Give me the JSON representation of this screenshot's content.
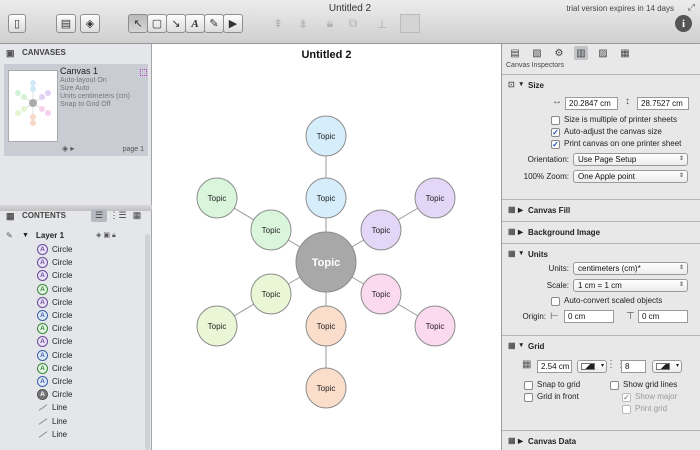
{
  "window": {
    "title": "Untitled 2",
    "trial_notice": "trial version expires in 14 days"
  },
  "toolbar": {
    "icons": [
      "sidebar-toggle-icon",
      "canvas-stack-icon",
      "layers-icon",
      "selection-tool-icon",
      "shape-tool-icon",
      "line-tool-icon",
      "text-tool-icon",
      "pen-tool-icon",
      "browse-tool-icon",
      "bring-front-icon",
      "send-back-icon",
      "lock-icon",
      "group-icon",
      "color-well-icon",
      "info-icon"
    ]
  },
  "sidebar": {
    "canvases_title": "CANVASES",
    "canvas": {
      "name": "Canvas 1",
      "props": [
        "Auto-layout On",
        "Size Auto",
        "Units centimeters (cm)",
        "Snap to Grid Off"
      ],
      "page_label": "page 1"
    },
    "contents_title": "CONTENTS",
    "layer_name": "Layer 1",
    "items": [
      {
        "type": "circle",
        "label": "Circle",
        "letter": "A",
        "tone": "purple"
      },
      {
        "type": "circle",
        "label": "Circle",
        "letter": "A",
        "tone": "purple"
      },
      {
        "type": "circle",
        "label": "Circle",
        "letter": "A",
        "tone": "purple"
      },
      {
        "type": "circle",
        "label": "Circle",
        "letter": "A",
        "tone": "green"
      },
      {
        "type": "circle",
        "label": "Circle",
        "letter": "A",
        "tone": "purple"
      },
      {
        "type": "circle",
        "label": "Circle",
        "letter": "A",
        "tone": "blue"
      },
      {
        "type": "circle",
        "label": "Circle",
        "letter": "A",
        "tone": "green"
      },
      {
        "type": "circle",
        "label": "Circle",
        "letter": "A",
        "tone": "purple"
      },
      {
        "type": "circle",
        "label": "Circle",
        "letter": "A",
        "tone": "blue"
      },
      {
        "type": "circle",
        "label": "Circle",
        "letter": "A",
        "tone": "green"
      },
      {
        "type": "circle",
        "label": "Circle",
        "letter": "A",
        "tone": "blue"
      },
      {
        "type": "circle",
        "label": "Circle",
        "letter": "A",
        "tone": "gray"
      },
      {
        "type": "line",
        "label": "Line"
      },
      {
        "type": "line",
        "label": "Line"
      },
      {
        "type": "line",
        "label": "Line"
      }
    ]
  },
  "canvas_view": {
    "title": "Untitled 2",
    "center": {
      "label": "Topic",
      "fill": "#a8a8a8"
    },
    "nodes": [
      {
        "label": "Topic",
        "fill": "#d6eefb"
      },
      {
        "label": "Topic",
        "fill": "#d6eefb"
      },
      {
        "label": "Topic",
        "fill": "#e4d6f7"
      },
      {
        "label": "Topic",
        "fill": "#e4d6f7"
      },
      {
        "label": "Topic",
        "fill": "#fbd9ef"
      },
      {
        "label": "Topic",
        "fill": "#fbd9ef"
      },
      {
        "label": "Topic",
        "fill": "#fbddcc"
      },
      {
        "label": "Topic",
        "fill": "#fbddcc"
      },
      {
        "label": "Topic",
        "fill": "#eaf7d6"
      },
      {
        "label": "Topic",
        "fill": "#eaf7d6"
      },
      {
        "label": "Topic",
        "fill": "#d9f5dc"
      },
      {
        "label": "Topic",
        "fill": "#d9f5dc"
      }
    ]
  },
  "inspector": {
    "title": "Canvas Inspectors",
    "size": {
      "title": "Size",
      "width": "20.2847 cm",
      "height": "28.7527 cm",
      "checks": [
        {
          "label": "Size is multiple of printer sheets",
          "checked": ""
        },
        {
          "label": "Auto-adjust the canvas size",
          "checked": "✓"
        },
        {
          "label": "Print canvas on one printer sheet",
          "checked": "✓"
        }
      ],
      "orientation_label": "Orientation:",
      "orientation_value": "Use Page Setup",
      "zoom_label": "100% Zoom:",
      "zoom_value": "One Apple point"
    },
    "canvas_fill": {
      "title": "Canvas Fill"
    },
    "background_image": {
      "title": "Background Image"
    },
    "units": {
      "title": "Units",
      "units_label": "Units:",
      "units_value": "centimeters (cm)*",
      "scale_label": "Scale:",
      "scale_value": "1 cm = 1 cm",
      "auto_convert": "Auto-convert scaled objects",
      "origin_label": "Origin:",
      "origin_x": "0 cm",
      "origin_y": "0 cm"
    },
    "grid": {
      "title": "Grid",
      "spacing": "2.54 cm",
      "steps": "8",
      "snap": "Snap to grid",
      "front": "Grid in front",
      "show_lines": "Show grid lines",
      "show_major": "Show major",
      "print_grid": "Print grid"
    },
    "canvas_data": {
      "title": "Canvas Data"
    }
  }
}
